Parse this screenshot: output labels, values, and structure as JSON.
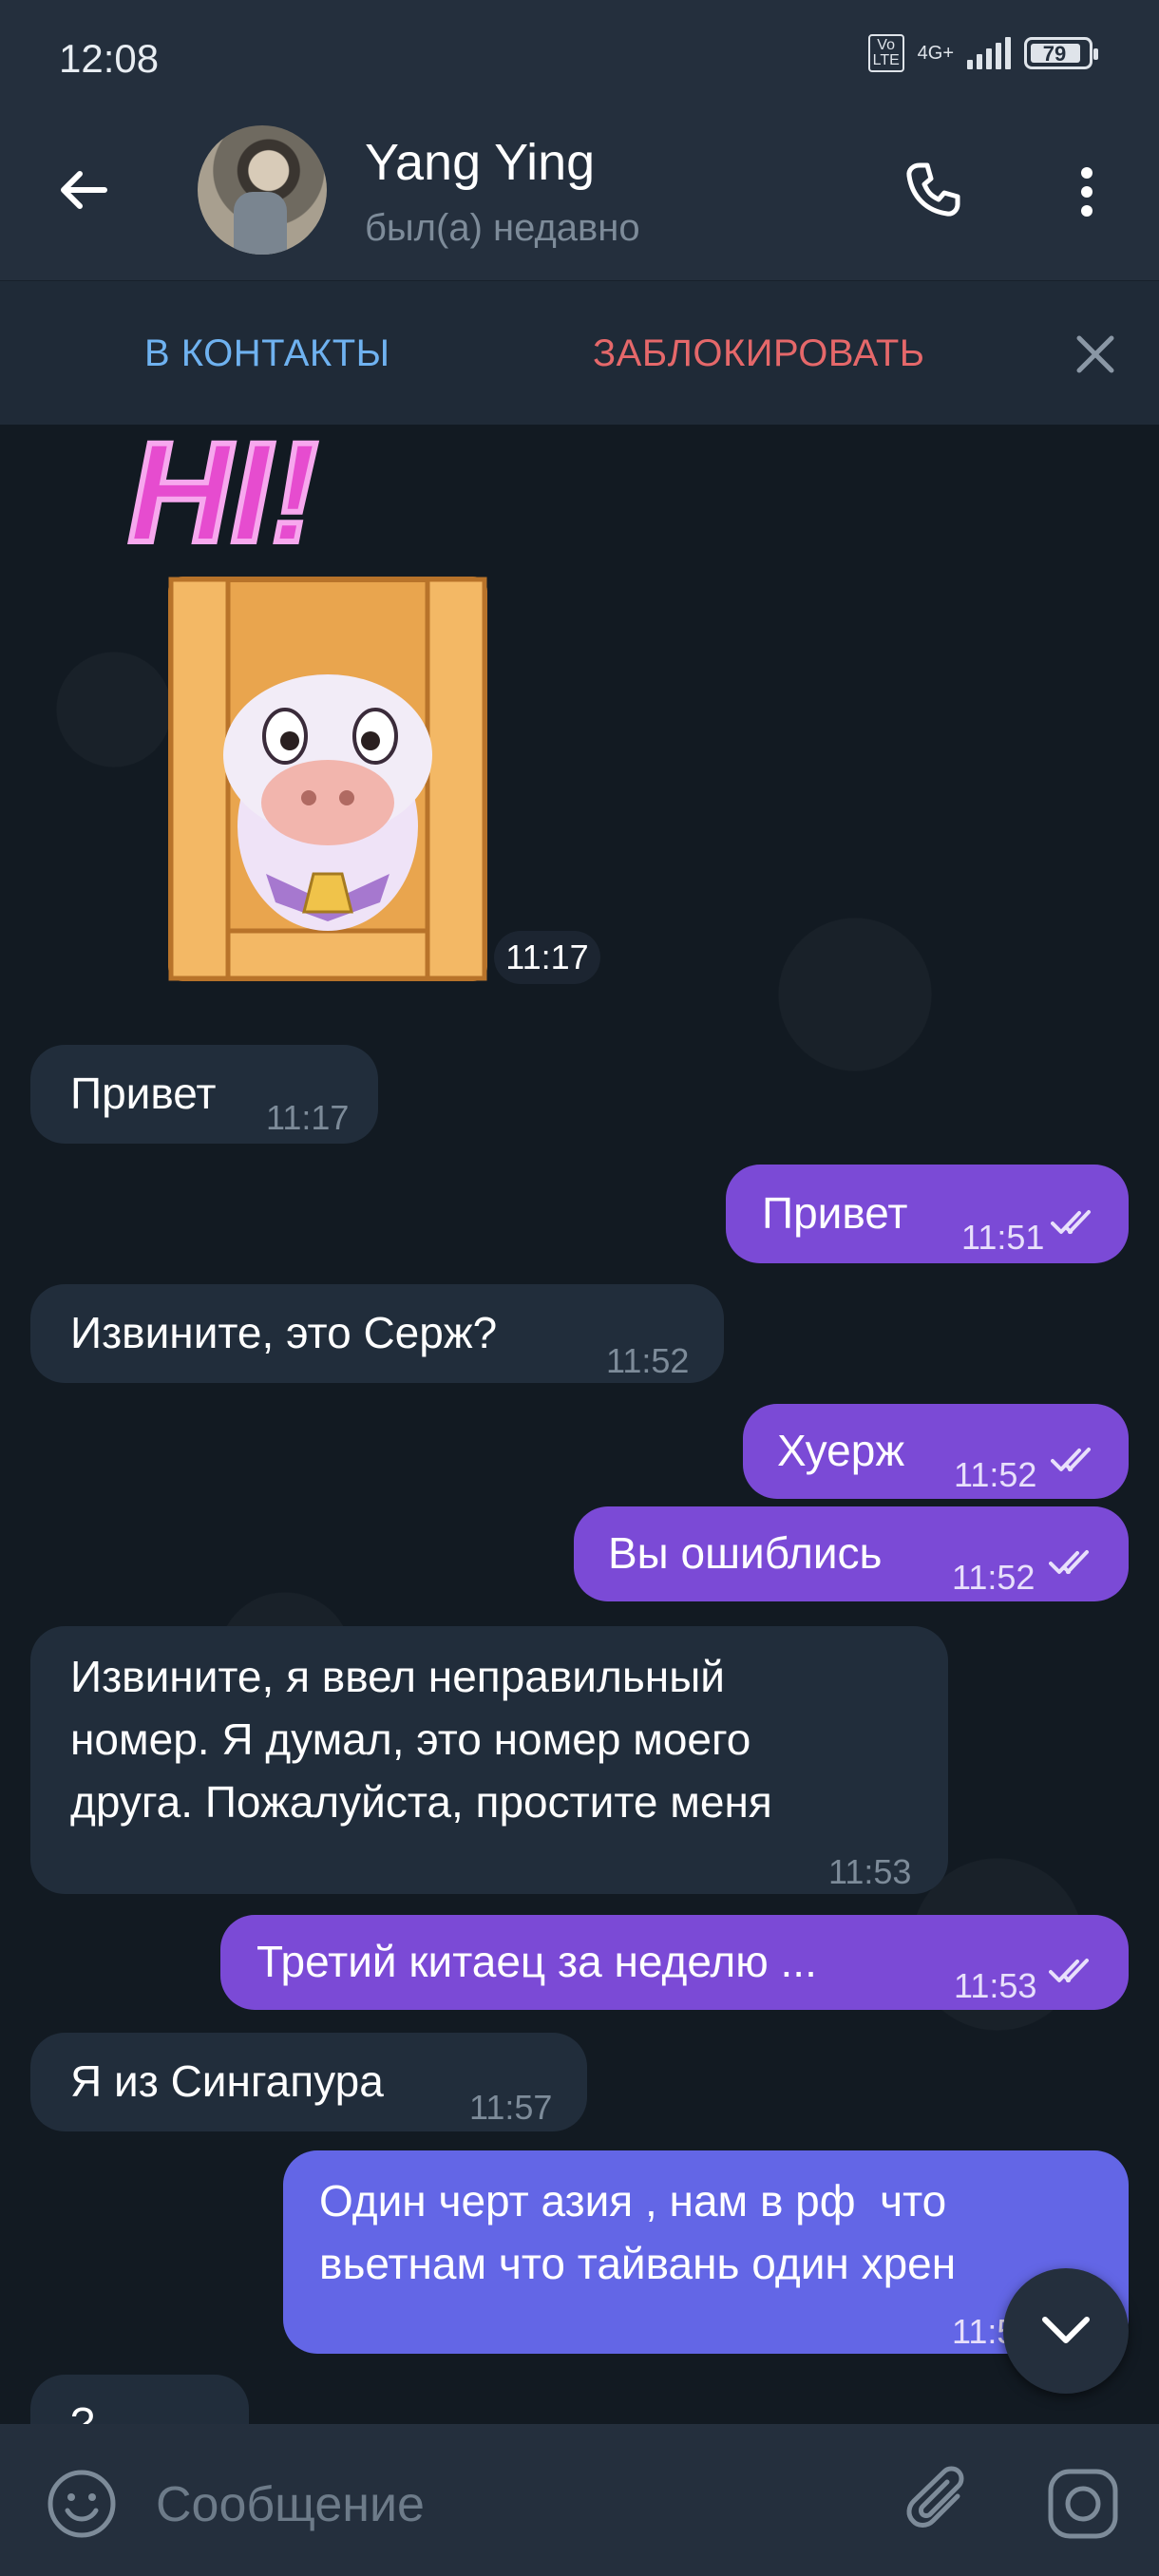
{
  "status_bar": {
    "time": "12:08",
    "volte": "Vo LTE",
    "network": "4G+",
    "battery": "79"
  },
  "header": {
    "name": "Yang Ying",
    "last_seen": "был(а) недавно"
  },
  "action_bar": {
    "add_contact": "В КОНТАКТЫ",
    "block": "ЗАБЛОКИРОВАТЬ"
  },
  "sticker": {
    "text": "HI!",
    "time": "11:17"
  },
  "messages": [
    {
      "text": "Привет",
      "time": "11:17"
    },
    {
      "text": "Привет",
      "time": "11:51"
    },
    {
      "text": "Извините, это Серж?",
      "time": "11:52"
    },
    {
      "text": "Хуерж",
      "time": "11:52"
    },
    {
      "text": "Вы ошиблись",
      "time": "11:52"
    },
    {
      "line1": "Извините, я ввел неправильный",
      "line2": "номер. Я думал, это номер моего",
      "line3": "друга. Пожалуйста, простите меня",
      "time": "11:53"
    },
    {
      "text": "Третий китаец за неделю ...",
      "time": "11:53"
    },
    {
      "text": "Я из Сингапура",
      "time": "11:57"
    },
    {
      "line1": "Один черт азия , нам в рф  что",
      "line2": "вьетнам что тайвань один хрен",
      "time": "11:5"
    }
  ],
  "partial_message": "?",
  "composer": {
    "placeholder": "Сообщение"
  },
  "colors": {
    "header_bg": "#242f3d",
    "chat_bg": "#121a22",
    "incoming": "#212d3b",
    "outgoing": "#7b4ad6",
    "outgoing_latest": "#6366e6",
    "link_blue": "#6fb2f0",
    "danger_red": "#e5686a"
  },
  "icons": [
    "back-arrow-icon",
    "phone-icon",
    "more-vert-icon",
    "close-icon",
    "double-check-icon",
    "chevron-down-icon",
    "emoji-icon",
    "attach-icon",
    "camera-icon"
  ]
}
